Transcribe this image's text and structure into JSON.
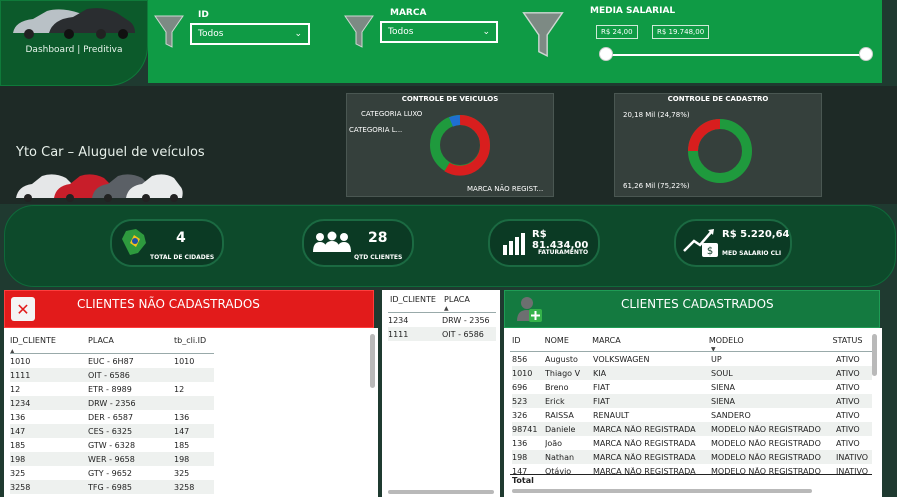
{
  "nav": {
    "label": "Dashboard | Preditiva"
  },
  "filters": {
    "id": {
      "label": "ID",
      "value": "Todos"
    },
    "marca": {
      "label": "MARCA",
      "value": "Todos"
    },
    "salario": {
      "label": "MEDIA SALARIAL",
      "min": "R$ 24,00",
      "max": "R$ 19.748,00"
    }
  },
  "brand": {
    "title": "Yto Car – Aluguel de veículos"
  },
  "veiculos": {
    "title": "CONTROLE DE VEICULOS",
    "labels": [
      "CATEGORIA LUXO",
      "CATEGORIA L...",
      "MARCA NÃO REGIST..."
    ],
    "colors": {
      "luxo": "#1f6fd1",
      "categoria": "#1f9a3d",
      "marca": "#d81e1e"
    }
  },
  "cadastro": {
    "title": "CONTROLE DE CADASTRO",
    "label_top": "20,18 Mil (24,78%)",
    "label_bottom": "61,26 Mil (75,22%)",
    "colors": {
      "a": "#d81e1e",
      "b": "#1f9a3d"
    }
  },
  "kpis": [
    {
      "value": "4",
      "label": "TOTAL DE CIDADES",
      "icon": "brazil-map-icon"
    },
    {
      "value": "28",
      "label": "QTD CLIENTES",
      "icon": "people-icon"
    },
    {
      "value": "R$ 81.434,00",
      "label": "FATURAMENTO",
      "icon": "bar-chart-icon"
    },
    {
      "value": "R$ 5.220,64",
      "label": "MED SALARIO CLI",
      "icon": "money-growth-icon"
    }
  ],
  "nao_cadastrados": {
    "title": "CLIENTES NÃO CADASTRADOS",
    "headers": [
      "ID_CLIENTE",
      "PLACA",
      "tb_cli.ID"
    ],
    "rows": [
      [
        "1010",
        "EUC - 6H87",
        "1010"
      ],
      [
        "1111",
        "OIT - 6586",
        ""
      ],
      [
        "12",
        "ETR - 8989",
        "12"
      ],
      [
        "1234",
        "DRW - 2356",
        ""
      ],
      [
        "136",
        "DER - 6587",
        "136"
      ],
      [
        "147",
        "CES - 6325",
        "147"
      ],
      [
        "185",
        "GTW - 6328",
        "185"
      ],
      [
        "198",
        "WER - 9658",
        "198"
      ],
      [
        "325",
        "GTY - 9652",
        "325"
      ],
      [
        "3258",
        "TFG - 6985",
        "3258"
      ]
    ]
  },
  "middle_table": {
    "headers": [
      "ID_CLIENTE",
      "PLACA"
    ],
    "rows": [
      [
        "1234",
        "DRW - 2356"
      ],
      [
        "1111",
        "OIT - 6586"
      ]
    ]
  },
  "cadastrados": {
    "title": "CLIENTES CADASTRADOS",
    "headers": [
      "ID",
      "NOME",
      "MARCA",
      "MODELO",
      "STATUS"
    ],
    "rows": [
      [
        "856",
        "Augusto",
        "VOLKSWAGEN",
        "UP",
        "ATIVO"
      ],
      [
        "1010",
        "Thiago V",
        "KIA",
        "SOUL",
        "ATIVO"
      ],
      [
        "696",
        "Breno",
        "FIAT",
        "SIENA",
        "ATIVO"
      ],
      [
        "523",
        "Erick",
        "FIAT",
        "SIENA",
        "ATIVO"
      ],
      [
        "326",
        "RAISSA",
        "RENAULT",
        "SANDERO",
        "ATIVO"
      ],
      [
        "98741",
        "Daniele",
        "MARCA NÃO REGISTRADA",
        "MODELO NÃO REGISTRADO",
        "ATIVO"
      ],
      [
        "136",
        "João",
        "MARCA NÃO REGISTRADA",
        "MODELO NÃO REGISTRADO",
        "ATIVO"
      ],
      [
        "198",
        "Nathan",
        "MARCA NÃO REGISTRADA",
        "MODELO NÃO REGISTRADO",
        "INATIVO"
      ],
      [
        "147",
        "Otávio",
        "MARCA NÃO REGISTRADA",
        "MODELO NÃO REGISTRADO",
        "INATIVO"
      ]
    ],
    "total_label": "Total"
  }
}
